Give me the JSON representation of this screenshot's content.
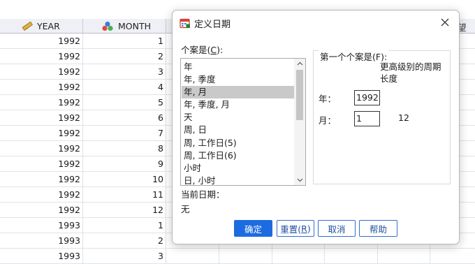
{
  "spreadsheet": {
    "columns": [
      {
        "name": "YEAR",
        "icon": "ruler-icon"
      },
      {
        "name": "MONTH",
        "icon": "nominal-balls-icon"
      }
    ],
    "rows": [
      {
        "year": "1992",
        "month": "1"
      },
      {
        "year": "1992",
        "month": "2"
      },
      {
        "year": "1992",
        "month": "3"
      },
      {
        "year": "1992",
        "month": "4"
      },
      {
        "year": "1992",
        "month": "5"
      },
      {
        "year": "1992",
        "month": "6"
      },
      {
        "year": "1992",
        "month": "7"
      },
      {
        "year": "1992",
        "month": "8"
      },
      {
        "year": "1992",
        "month": "9"
      },
      {
        "year": "1992",
        "month": "10"
      },
      {
        "year": "1992",
        "month": "11"
      },
      {
        "year": "1992",
        "month": "12"
      },
      {
        "year": "1993",
        "month": "1"
      },
      {
        "year": "1993",
        "month": "2"
      },
      {
        "year": "1993",
        "month": "3"
      }
    ],
    "partial_header_glyph": "望"
  },
  "dialog": {
    "title": "定义日期",
    "cases_label": "个案是(",
    "cases_label_key": "C",
    "cases_label_end": "):",
    "case_options": [
      "年",
      "年, 季度",
      "年, 月",
      "年, 季度, 月",
      "天",
      "周, 日",
      "周, 工作日(5)",
      "周, 工作日(6)",
      "小时",
      "日, 小时"
    ],
    "selected_option": "年, 月",
    "first_case_label": "第一个个案是(F):",
    "higher_period_label": "更高级别的周期\n长度",
    "year_label": "年：",
    "year_value": "1992",
    "month_label": "月：",
    "month_value": "1",
    "month_period": "12",
    "current_dates_label": "当前日期：",
    "current_dates_value": "无",
    "buttons": {
      "ok": "确定",
      "reset_pre": "重置(",
      "reset_key": "R",
      "reset_post": ")",
      "cancel": "取消",
      "help": "帮助"
    }
  },
  "colors": {
    "primary_button": "#1c6be0",
    "selection": "#c9c9c9",
    "header_bg": "#eef0f5"
  }
}
